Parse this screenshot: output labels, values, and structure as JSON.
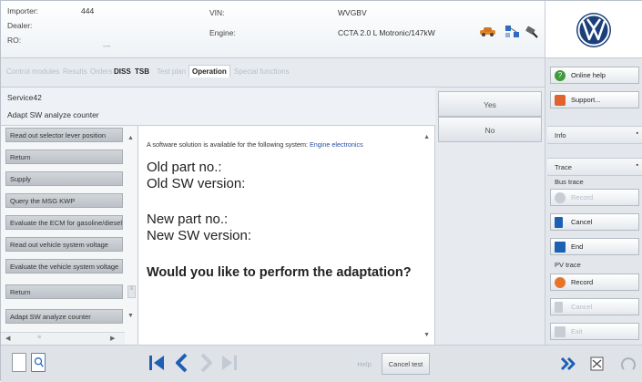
{
  "header": {
    "importer_label": "Importer:",
    "importer_value": "444",
    "dealer_label": "Dealer:",
    "ro_label": "RO:",
    "ro_value": "---",
    "vin_label": "VIN:",
    "vin_value": "WVGBV",
    "engine_label": "Engine:",
    "engine_value": "CCTA 2.0 L Motronic/147kW",
    "icons": [
      "car-icon",
      "network-icon",
      "diagnostic-plug-icon"
    ]
  },
  "tabs": [
    {
      "label": "Control modules",
      "state": "disabled"
    },
    {
      "label": "Results",
      "state": "disabled"
    },
    {
      "label": "Orders",
      "state": "disabled"
    },
    {
      "label": "DISS",
      "state": "enabled"
    },
    {
      "label": "TSB",
      "state": "enabled"
    },
    {
      "label": "Test plan",
      "state": "disabled"
    },
    {
      "label": "Operation",
      "state": "active"
    },
    {
      "label": "Special functions",
      "state": "disabled"
    }
  ],
  "title": {
    "line1": "Service42",
    "line2": "Adapt SW analyze counter"
  },
  "test_list": [
    "Read out selector lever position",
    "Return",
    "Supply",
    "Query the MSG KWP",
    "Evaluate the ECM for gasoline/diesel",
    "Read out vehicle system voltage",
    "Evaluate the vehicle system voltage",
    "Return",
    "Adapt SW analyze counter"
  ],
  "message": {
    "intro": "A software solution is available for the following system:",
    "system": "Engine electronics",
    "old_part": "Old part no.:",
    "old_sw": "Old SW version:",
    "new_part": "New part no.:",
    "new_sw": "New SW version:",
    "question": "Would you like to perform the adaptation?"
  },
  "answers": {
    "yes": "Yes",
    "no": "No"
  },
  "sidebar": {
    "online_help": "Online help",
    "support": "Support...",
    "info": "Info",
    "trace": "Trace",
    "bus_trace": "Bus trace",
    "bus_record": "Record",
    "bus_cancel": "Cancel",
    "bus_end": "End",
    "pv_trace": "PV trace",
    "pv_record": "Record",
    "pv_cancel": "Cancel",
    "pv_exit": "Exit"
  },
  "bottom": {
    "help": "Help",
    "cancel_test": "Cancel test"
  },
  "colors": {
    "accent_blue": "#1d5fb3",
    "link_blue": "#2a4fa0",
    "record_orange": "#e8742a",
    "help_green": "#3e9a3a"
  }
}
